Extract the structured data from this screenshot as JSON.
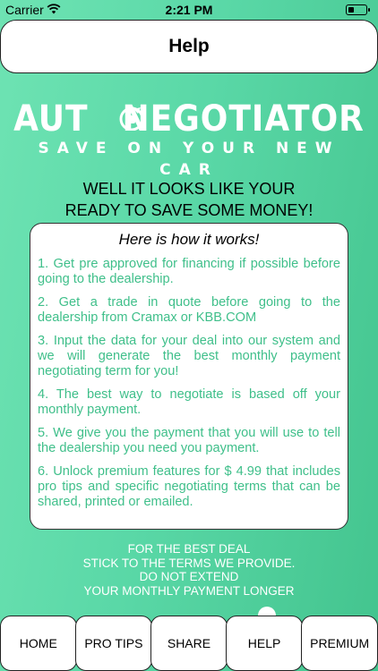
{
  "status_bar": {
    "carrier": "Carrier",
    "time": "2:21 PM"
  },
  "header": {
    "title": "Help"
  },
  "logo": {
    "text_left": "AUT",
    "text_right": "NEGOTIATOR",
    "tagline": "SAVE ON YOUR NEW CAR"
  },
  "headline": {
    "line1": "WELL IT LOOKS LIKE YOUR",
    "line2": "READY TO SAVE SOME MONEY!"
  },
  "card": {
    "title": "Here is how it works!",
    "steps": [
      "1. Get pre approved for financing if possible before going to the dealership.",
      "2. Get a trade in quote before going to the dealership from Cramax or KBB.COM",
      "3. Input the data for your deal into our system and we will generate the best monthly payment negotiating term for you!",
      "4. The best way to negotiate is based off your monthly payment.",
      "5. We give you the payment that you will use to tell the dealership you need you payment.",
      "6. Unlock premium features for $ 4.99 that includes pro tips and specific negotiating terms that can be shared, printed or emailed."
    ]
  },
  "advice": {
    "line1": "FOR THE BEST DEAL",
    "line2": "STICK TO THE TERMS WE PROVIDE.",
    "line3": "DO NOT EXTEND",
    "line4": "YOUR MONTHLY PAYMENT LONGER"
  },
  "tabbar": {
    "home": "HOME",
    "pro_tips": "PRO TIPS",
    "share": "SHARE",
    "help": "HELP",
    "premium": "PREMIUM"
  },
  "icons": {
    "wifi": "wifi-icon",
    "battery": "battery-icon",
    "logo_hand": "hand-pointer-icon"
  },
  "colors": {
    "background_start": "#6ee3b3",
    "background_end": "#43c48e",
    "step_text": "#3fbf8a"
  }
}
